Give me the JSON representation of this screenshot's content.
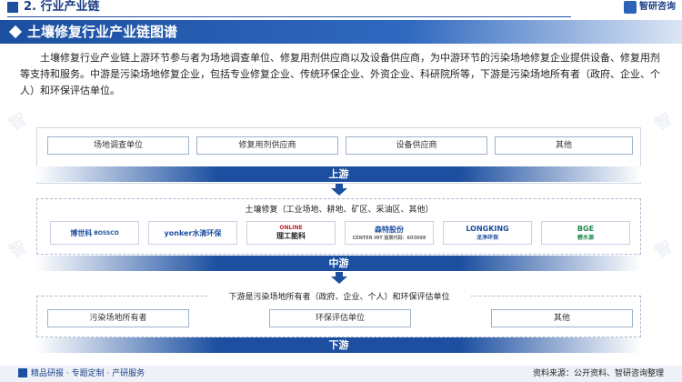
{
  "header": {
    "section_title": "2. 行业产业链",
    "logo_text": "智研咨询"
  },
  "title_bar": {
    "title": "土壤修复行业产业链图谱"
  },
  "intro": "土壤修复行业产业链上游环节参与者为场地调查单位、修复用剂供应商以及设备供应商，为中游环节的污染场地修复企业提供设备、修复用剂等支持和服务。中游是污染场地修复企业，包括专业修复企业、传统环保企业、外资企业、科研院所等，下游是污染场地所有者（政府、企业、个人）和环保评估单位。",
  "upstream": {
    "items": [
      "场地调查单位",
      "修复用剂供应商",
      "设备供应商",
      "其他"
    ],
    "label": "上游"
  },
  "midstream": {
    "title": "土壤修复（工业场地、耕地、矿区、采油区、其他）",
    "companies": [
      {
        "name": "博世科",
        "sub": "BOSSCO"
      },
      {
        "name": "yonker水清环保",
        "sub": ""
      },
      {
        "name": "理工能科",
        "sub": "ONLINE"
      },
      {
        "name": "森特股份",
        "sub": "CENTER INT 股票代码：603098"
      },
      {
        "name": "LONGKING",
        "sub": "龙净环保"
      },
      {
        "name": "BGE",
        "sub": "碧水源"
      }
    ],
    "label": "中游"
  },
  "downstream": {
    "title": "下游是污染场地所有者（政府、企业、个人）和环保评估单位",
    "items": [
      "污染场地所有者",
      "环保评估单位",
      "其他"
    ],
    "label": "下游"
  },
  "footer": {
    "left": "精品研报 · 专题定制 · 产研服务",
    "right": "资料来源：公开资料、智研咨询整理"
  },
  "colors": {
    "primary": "#1c4fa0",
    "accent": "#3069c0"
  }
}
